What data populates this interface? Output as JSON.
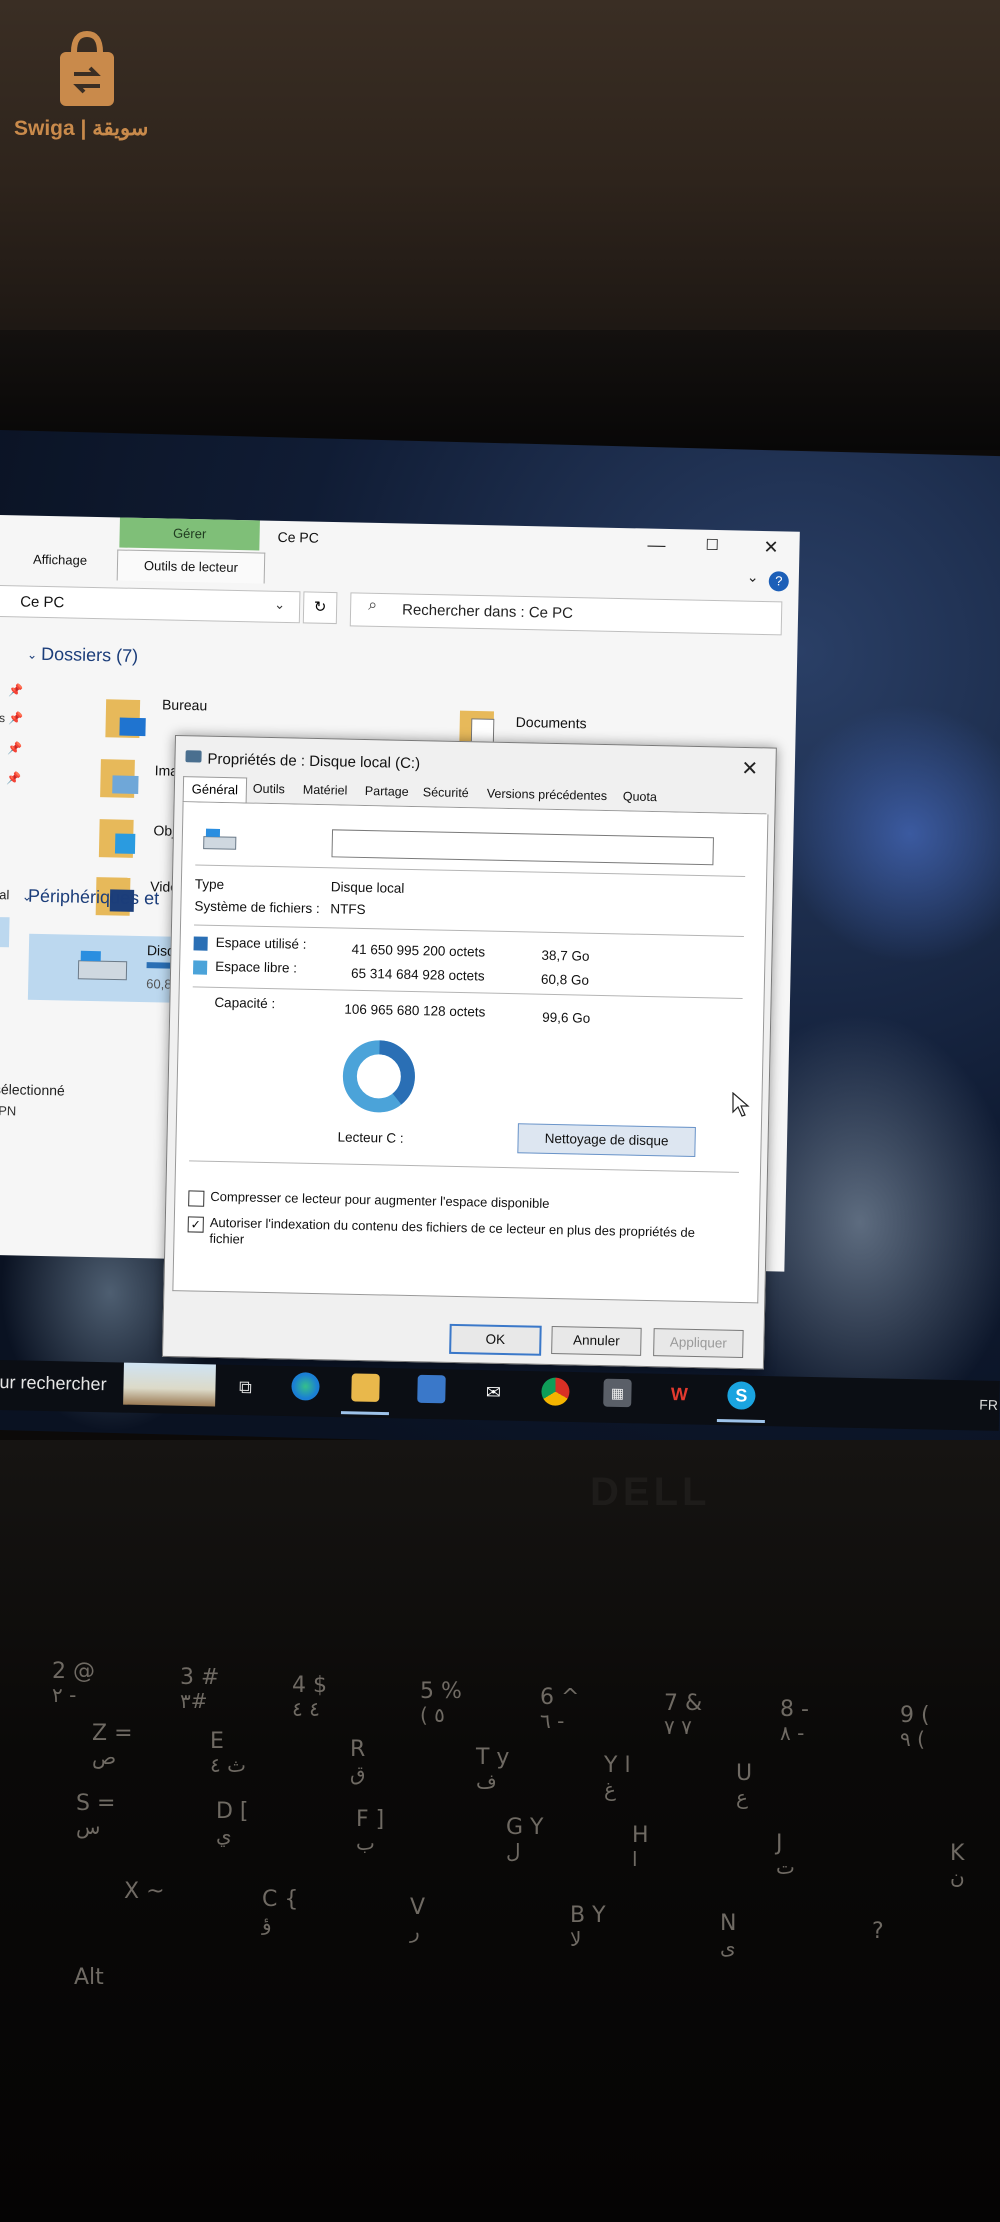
{
  "logo": {
    "text": "Swiga | سويقة"
  },
  "explorer": {
    "ribbon": {
      "manage_tab": "Gérer",
      "drive_tools_tab": "Outils de lecteur",
      "view_tab": "Affichage"
    },
    "window_title": "Ce PC",
    "controls": {
      "minimize": "—",
      "maximize": "☐",
      "close": "✕",
      "collapse": "⌄",
      "help": "?"
    },
    "address": {
      "path": "Ce PC",
      "chevron": "⌄",
      "refresh": "↻"
    },
    "search": {
      "placeholder": "Rechercher dans : Ce PC"
    },
    "folders_header": "Dossiers (7)",
    "folders": [
      {
        "label": "Bureau"
      },
      {
        "label": "Documents"
      },
      {
        "label": "Imag"
      },
      {
        "label": "Obje"
      },
      {
        "label": "Vidéc"
      }
    ],
    "devices_header": "Périphériques et",
    "drive": {
      "label": "Disqu",
      "size": "60,8"
    },
    "status": "sélectionné",
    "vpn": "VPN",
    "nav_fragments": [
      "ts",
      "nal"
    ]
  },
  "dialog": {
    "title": "Propriétés de : Disque local (C:)",
    "close": "✕",
    "tabs": [
      "Général",
      "Outils",
      "Matériel",
      "Partage",
      "Sécurité",
      "Versions précédentes",
      "Quota"
    ],
    "name_value": "",
    "type_label": "Type",
    "type_value": "Disque local",
    "fs_label": "Système de fichiers :",
    "fs_value": "NTFS",
    "used_label": "Espace utilisé :",
    "used_bytes": "41 650 995 200 octets",
    "used_size": "38,7 Go",
    "free_label": "Espace libre :",
    "free_bytes": "65 314 684 928 octets",
    "free_size": "60,8 Go",
    "capacity_label": "Capacité :",
    "capacity_bytes": "106 965 680 128 octets",
    "capacity_size": "99,6 Go",
    "used_fraction": 0.389,
    "used_color": "#2a6fb5",
    "free_color": "#4ba3d9",
    "drive_label": "Lecteur C :",
    "cleanup_button": "Nettoyage de disque",
    "compress_label": "Compresser ce lecteur pour augmenter l'espace disponible",
    "compress_checked": false,
    "index_label_line1": "Autoriser l'indexation du contenu des fichiers de ce lecteur en plus des propriétés de",
    "index_label_line2": "fichier",
    "index_checked": true,
    "check_mark": "✓",
    "ok": "OK",
    "cancel": "Annuler",
    "apply": "Appliquer"
  },
  "taskbar": {
    "search_text": "ur rechercher",
    "lang": "FR",
    "icons": [
      "task-view-icon",
      "edge-icon",
      "file-explorer-icon",
      "store-icon",
      "mail-icon",
      "chrome-icon",
      "calculator-icon",
      "wps-icon",
      "skype-icon"
    ]
  },
  "keyboard": {
    "brand": "DELL",
    "keys": [
      {
        "latin": "2  @",
        "arabic": "٢  -"
      },
      {
        "latin": "3  #",
        "arabic": "٣#"
      },
      {
        "latin": "4  $",
        "arabic": "٤  ٤"
      },
      {
        "latin": "5  %",
        "arabic": "( ٥"
      },
      {
        "latin": "6  ^",
        "arabic": "٦  -"
      },
      {
        "latin": "7  &",
        "arabic": "٧  ٧"
      },
      {
        "latin": "8  -",
        "arabic": "٨  -"
      },
      {
        "latin": "9  (",
        "arabic": "٩  ("
      },
      {
        "latin": "Z  =",
        "arabic": "ص"
      },
      {
        "latin": "E",
        "arabic": "ث ٤"
      },
      {
        "latin": "R",
        "arabic": "ق"
      },
      {
        "latin": "T  y",
        "arabic": "ف"
      },
      {
        "latin": "Y  ا",
        "arabic": "غ"
      },
      {
        "latin": "U",
        "arabic": "ع"
      },
      {
        "latin": "S  =",
        "arabic": "س"
      },
      {
        "latin": "D  [",
        "arabic": "ي"
      },
      {
        "latin": "F  ]",
        "arabic": "ب"
      },
      {
        "latin": "G  Y",
        "arabic": "ل"
      },
      {
        "latin": "H",
        "arabic": "ا"
      },
      {
        "latin": "J",
        "arabic": "ت"
      },
      {
        "latin": "K",
        "arabic": "ن"
      },
      {
        "latin": "X  ~",
        "arabic": ""
      },
      {
        "latin": "C  {",
        "arabic": "ؤ"
      },
      {
        "latin": "V",
        "arabic": "ر"
      },
      {
        "latin": "B  Y",
        "arabic": "لا"
      },
      {
        "latin": "N",
        "arabic": "ى"
      },
      {
        "latin": "?",
        "arabic": ""
      },
      {
        "latin": "Alt",
        "arabic": ""
      }
    ]
  }
}
